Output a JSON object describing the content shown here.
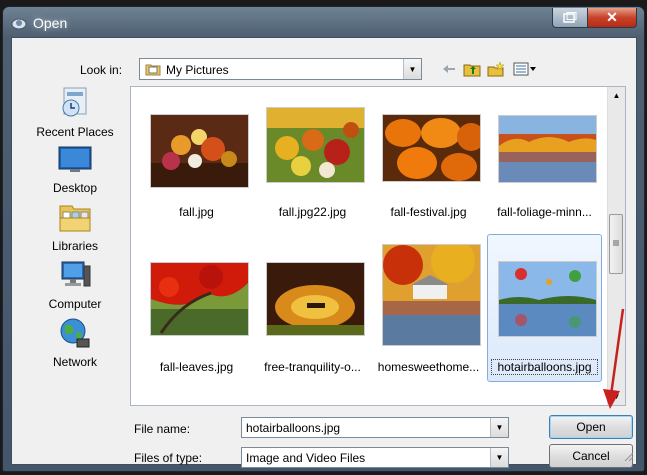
{
  "window": {
    "title": "Open"
  },
  "titlebar": {
    "close_glyph": "✕"
  },
  "lookin": {
    "label": "Look in:",
    "value": "My Pictures"
  },
  "places": [
    {
      "label": "Recent Places",
      "icon": "recent-places-icon"
    },
    {
      "label": "Desktop",
      "icon": "desktop-icon"
    },
    {
      "label": "Libraries",
      "icon": "libraries-icon"
    },
    {
      "label": "Computer",
      "icon": "computer-icon"
    },
    {
      "label": "Network",
      "icon": "network-icon"
    }
  ],
  "files": [
    {
      "name": "fall.jpg"
    },
    {
      "name": "fall.jpg22.jpg"
    },
    {
      "name": "fall-festival.jpg"
    },
    {
      "name": "fall-foliage-minn..."
    },
    {
      "name": "fall-leaves.jpg"
    },
    {
      "name": "free-tranquility-o..."
    },
    {
      "name": "homesweethome..."
    },
    {
      "name": "hotairballoons.jpg",
      "selected": true
    }
  ],
  "filename": {
    "label": "File name:",
    "value": "hotairballoons.jpg"
  },
  "filetype": {
    "label": "Files of type:",
    "value": "Image and Video Files"
  },
  "buttons": {
    "open": "Open",
    "cancel": "Cancel"
  },
  "colors": {
    "selection_border": "#84acdd",
    "annotation_arrow": "#c8201e",
    "close_button": "#c7432b"
  }
}
